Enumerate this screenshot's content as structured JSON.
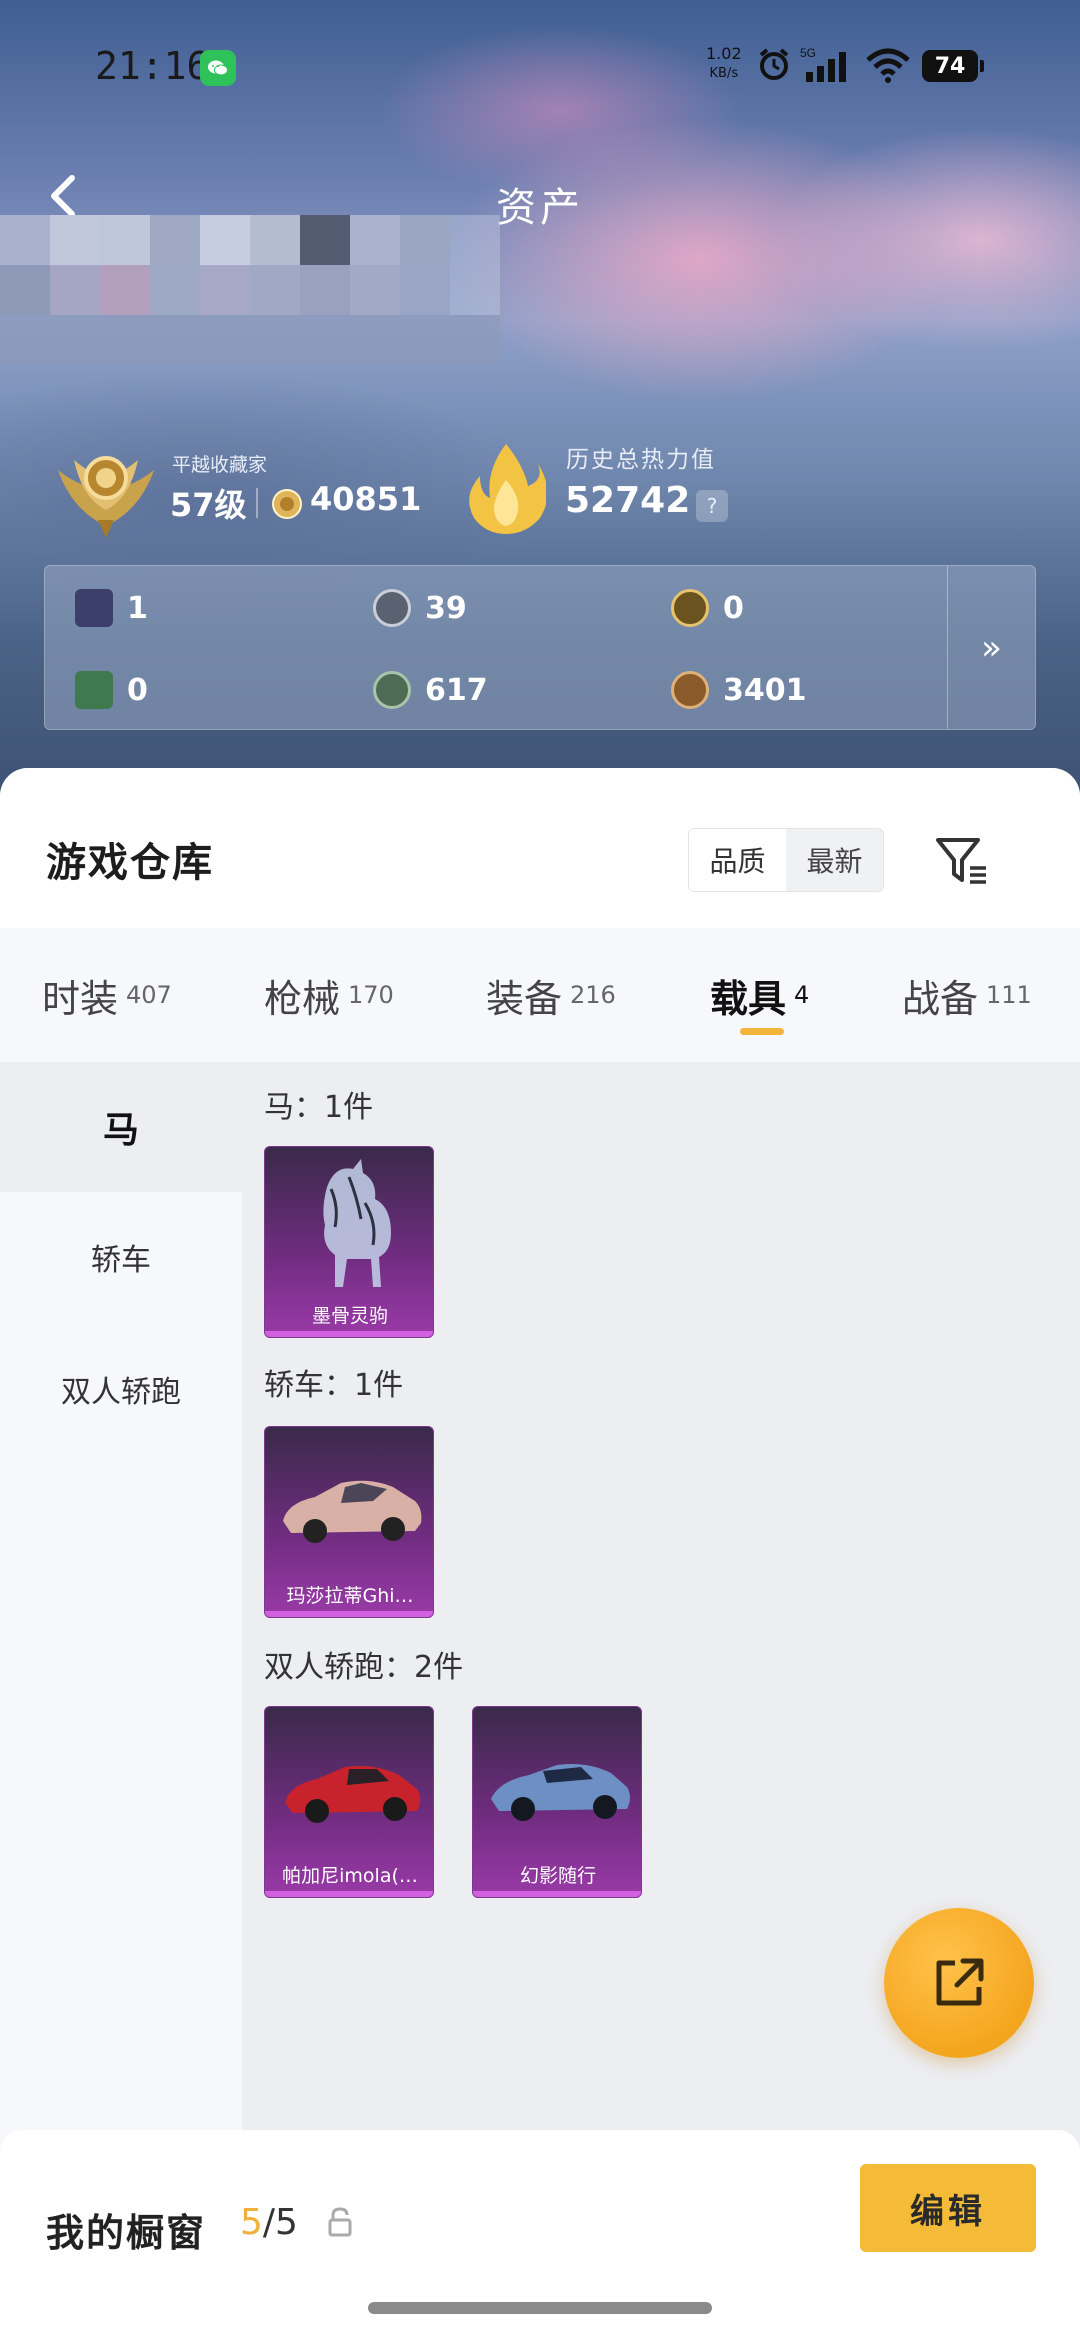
{
  "status_bar": {
    "time": "21:16",
    "net_speed_value": "1.02",
    "net_speed_unit": "KB/s",
    "network": "5G",
    "battery": "74"
  },
  "header": {
    "title": "资产"
  },
  "profile": {
    "rank_caption": "平越收藏家",
    "level": "57级",
    "points": "40851",
    "heat_caption": "历史总热力值",
    "heat_value": "52742",
    "help_label": "?"
  },
  "currencies": [
    {
      "icon": "card-icon",
      "value": "1",
      "color": "#3b3f6a"
    },
    {
      "icon": "silver-coin-icon",
      "value": "39",
      "color": "#5a6170"
    },
    {
      "icon": "gold-token-icon",
      "value": "0",
      "color": "#6b5320"
    },
    {
      "icon": "green-ticket-icon",
      "value": "0",
      "color": "#3f7a4e"
    },
    {
      "icon": "green-coin-icon",
      "value": "617",
      "color": "#4e6b55"
    },
    {
      "icon": "bronze-coin-icon",
      "value": "3401",
      "color": "#8a5a2a"
    }
  ],
  "currency_more_label": "»",
  "warehouse": {
    "title": "游戏仓库",
    "sort_options": [
      "品质",
      "最新"
    ],
    "tabs": [
      {
        "label": "时装",
        "count": "407"
      },
      {
        "label": "枪械",
        "count": "170"
      },
      {
        "label": "装备",
        "count": "216"
      },
      {
        "label": "载具",
        "count": "4"
      },
      {
        "label": "战备",
        "count": "111"
      }
    ],
    "active_tab": "载具",
    "categories": [
      "马",
      "轿车",
      "双人轿跑"
    ],
    "active_category": "马",
    "groups": [
      {
        "title": "马：1件",
        "items": [
          {
            "name": "墨骨灵驹",
            "art": "horse"
          }
        ]
      },
      {
        "title": "轿车：1件",
        "items": [
          {
            "name": "玛莎拉蒂Ghi…",
            "art": "sedan"
          }
        ]
      },
      {
        "title": "双人轿跑：2件",
        "items": [
          {
            "name": "帕加尼imola(…",
            "art": "red-coupe"
          },
          {
            "name": "幻影随行",
            "art": "blue-coupe"
          }
        ]
      }
    ]
  },
  "showcase": {
    "label": "我的橱窗",
    "used": "5",
    "total": "/5",
    "edit_label": "编辑"
  },
  "colors": {
    "accent": "#f5ba38",
    "rarity_purple": "#9a3aa8"
  }
}
